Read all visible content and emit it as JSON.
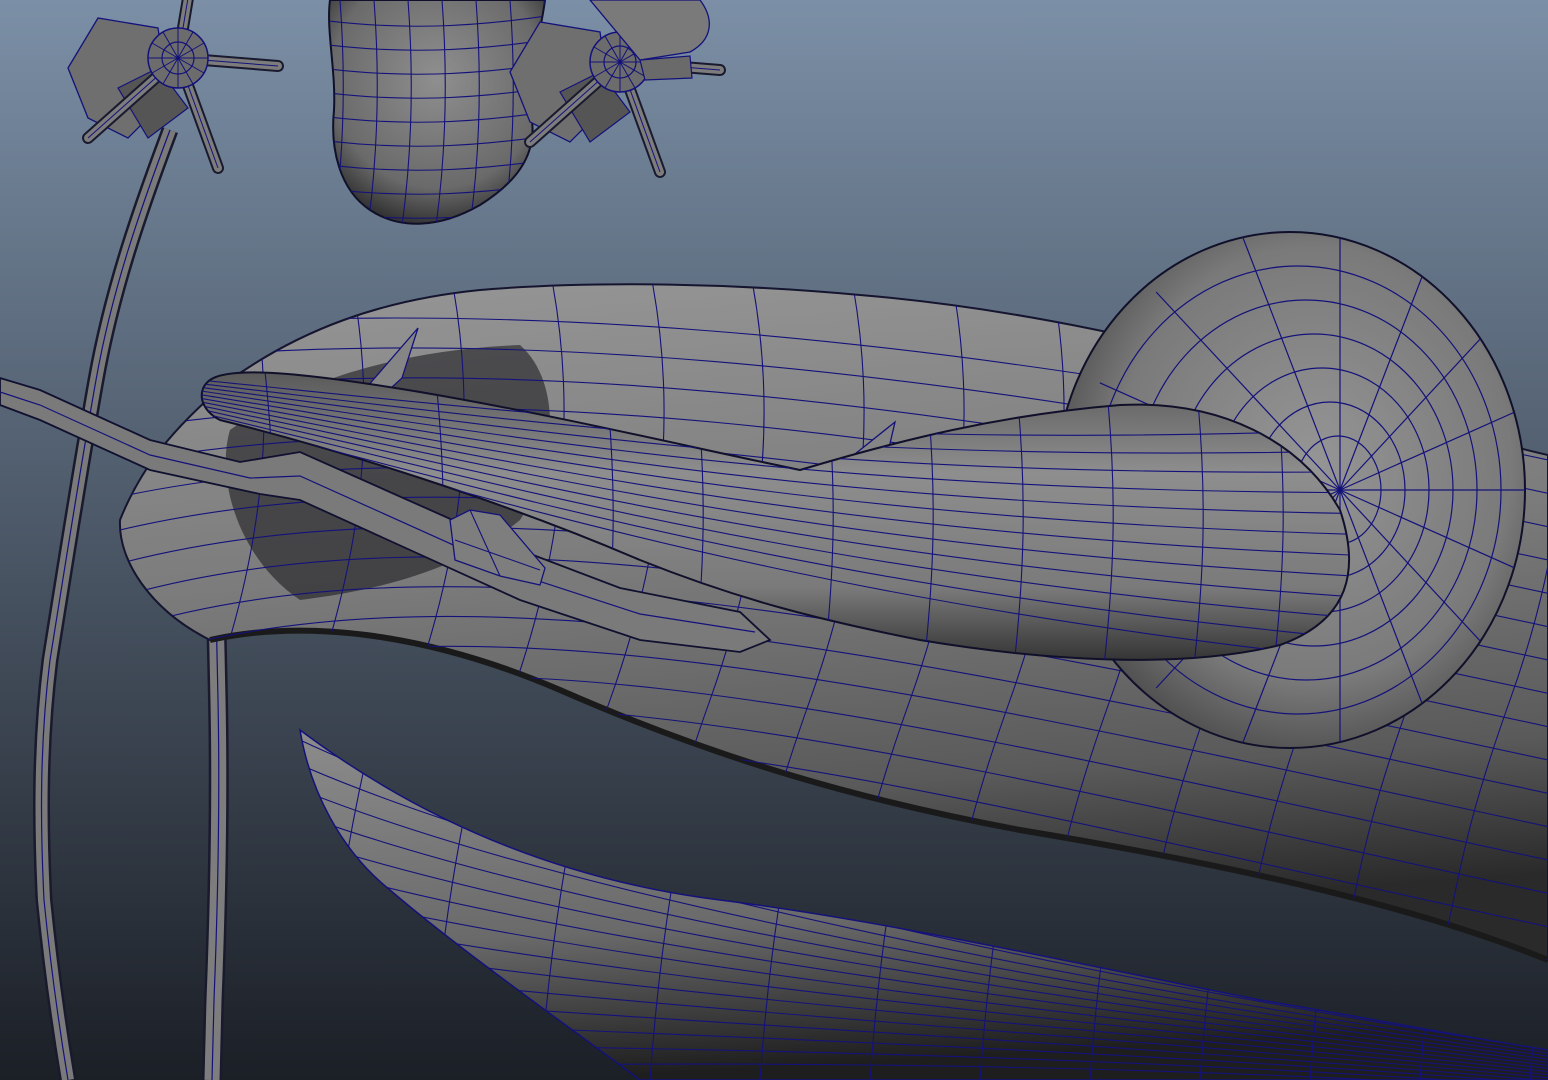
{
  "viewport": {
    "name": "3d-viewport-wireframe-on-shaded",
    "background_top": "#7b8fa6",
    "background_bottom": "#1b1f26",
    "surface_light": "#8a8a8a",
    "surface_mid": "#6e6e6e",
    "surface_dark": "#2c2c2c",
    "wire_color": "#14127a"
  },
  "objects": [
    {
      "name": "main-hull",
      "kind": "tube"
    },
    {
      "name": "trumpet-bell",
      "kind": "bell"
    },
    {
      "name": "mouth-tube",
      "kind": "tube"
    },
    {
      "name": "handle-bar",
      "kind": "bracket"
    },
    {
      "name": "small-knob",
      "kind": "knob"
    },
    {
      "name": "left-cable",
      "kind": "cable"
    },
    {
      "name": "mid-cable",
      "kind": "cable"
    },
    {
      "name": "left-flower",
      "kind": "flower"
    },
    {
      "name": "center-bulb",
      "kind": "bulb"
    },
    {
      "name": "right-flower",
      "kind": "flower"
    },
    {
      "name": "fin-left",
      "kind": "fin"
    },
    {
      "name": "fin-right",
      "kind": "fin"
    }
  ]
}
